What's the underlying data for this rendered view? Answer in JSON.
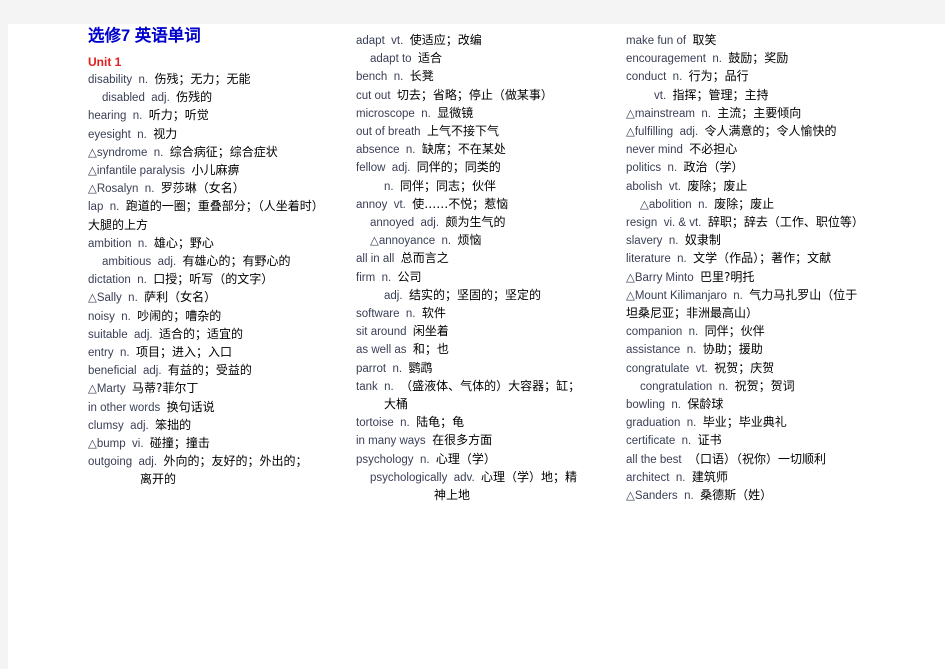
{
  "document": {
    "title": "选修7  英语单词",
    "unit": "Unit 1",
    "page_background": "#ffffff",
    "canvas_background": "#f4f4f4",
    "title_color": "#0000cc",
    "unit_color": "#e02020",
    "english_color": "#3a3f55",
    "chinese_color": "#000000"
  },
  "columns": [
    {
      "id": "column-1",
      "entries": [
        {
          "en": "disability",
          "pos": "n.",
          "zh": "伤残；无力；无能",
          "indent": 0
        },
        {
          "en": "disabled",
          "pos": "adj.",
          "zh": "伤残的",
          "indent": 1
        },
        {
          "en": "hearing",
          "pos": "n.",
          "zh": "听力；听觉",
          "indent": 0
        },
        {
          "en": "eyesight",
          "pos": "n.",
          "zh": "视力",
          "indent": 0
        },
        {
          "en": "△syndrome",
          "pos": "n.",
          "zh": "综合病征；综合症状",
          "indent": 0
        },
        {
          "en": "△infantile paralysis",
          "pos": "",
          "zh": "小儿麻痹",
          "indent": 0
        },
        {
          "en": "△Rosalyn",
          "pos": "n.",
          "zh": "罗莎琳（女名）",
          "indent": 0
        },
        {
          "en": "lap",
          "pos": "n.",
          "zh": "跑道的一圈；重叠部分；（人坐着时）",
          "indent": 0
        },
        {
          "en": "",
          "pos": "",
          "zh": "大腿的上方",
          "indent": 0
        },
        {
          "en": "ambition",
          "pos": "n.",
          "zh": "雄心；野心",
          "indent": 0
        },
        {
          "en": "ambitious",
          "pos": "adj.",
          "zh": "有雄心的；有野心的",
          "indent": 1
        },
        {
          "en": "dictation",
          "pos": "n.",
          "zh": "口授；听写（的文字）",
          "indent": 0
        },
        {
          "en": "△Sally",
          "pos": "n.",
          "zh": "萨利（女名）",
          "indent": 0
        },
        {
          "en": "noisy",
          "pos": "n.",
          "zh": "吵闹的；嘈杂的",
          "indent": 0
        },
        {
          "en": "suitable",
          "pos": "adj.",
          "zh": "适合的；适宜的",
          "indent": 0
        },
        {
          "en": "entry",
          "pos": "n.",
          "zh": "项目；进入；入口",
          "indent": 0
        },
        {
          "en": "beneficial",
          "pos": "adj.",
          "zh": "有益的；受益的",
          "indent": 0
        },
        {
          "en": "△Marty",
          "pos": "",
          "zh": "马蒂?菲尔丁",
          "indent": 0
        },
        {
          "en": "in other words",
          "pos": "",
          "zh": "换句话说",
          "indent": 0
        },
        {
          "en": "clumsy",
          "pos": "adj.",
          "zh": "笨拙的",
          "indent": 0
        },
        {
          "en": "△bump",
          "pos": "vi.",
          "zh": "碰撞；撞击",
          "indent": 0
        },
        {
          "en": "outgoing",
          "pos": "adj.",
          "zh": "外向的；友好的；外出的；",
          "indent": 0
        },
        {
          "en": "",
          "pos": "",
          "zh": "离开的",
          "indent": 3
        }
      ]
    },
    {
      "id": "column-2",
      "entries": [
        {
          "en": "adapt",
          "pos": "vt.",
          "zh": "使适应；改编",
          "indent": 0
        },
        {
          "en": "adapt to",
          "pos": "",
          "zh": "适合",
          "indent": 1
        },
        {
          "en": "bench",
          "pos": "n.",
          "zh": "长凳",
          "indent": 0
        },
        {
          "en": "cut out",
          "pos": "",
          "zh": "切去；省略；停止（做某事）",
          "indent": 0
        },
        {
          "en": "microscope",
          "pos": "n.",
          "zh": "显微镜",
          "indent": 0
        },
        {
          "en": "out of breath",
          "pos": "",
          "zh": "上气不接下气",
          "indent": 0
        },
        {
          "en": "absence",
          "pos": "n.",
          "zh": "缺席；不在某处",
          "indent": 0
        },
        {
          "en": "fellow",
          "pos": "adj.",
          "zh": "同伴的；同类的",
          "indent": 0
        },
        {
          "en": "",
          "pos": "n.",
          "zh": "同伴；同志；伙伴",
          "indent": 2
        },
        {
          "en": "annoy",
          "pos": "vt.",
          "zh": "使……不悦；惹恼",
          "indent": 0
        },
        {
          "en": "annoyed",
          "pos": "adj.",
          "zh": "颇为生气的",
          "indent": 1
        },
        {
          "en": "△annoyance",
          "pos": "n.",
          "zh": "烦恼",
          "indent": 1
        },
        {
          "en": "all in all",
          "pos": "",
          "zh": "总而言之",
          "indent": 0
        },
        {
          "en": "firm",
          "pos": "n.",
          "zh": "公司",
          "indent": 0
        },
        {
          "en": "",
          "pos": "adj.",
          "zh": "结实的；坚固的；坚定的",
          "indent": 2
        },
        {
          "en": "software",
          "pos": "n.",
          "zh": "软件",
          "indent": 0
        },
        {
          "en": "sit around",
          "pos": "",
          "zh": "闲坐着",
          "indent": 0
        },
        {
          "en": "as well as",
          "pos": "",
          "zh": "和；也",
          "indent": 0
        },
        {
          "en": "parrot",
          "pos": "n.",
          "zh": "鹦鹉",
          "indent": 0
        },
        {
          "en": "tank",
          "pos": "n.",
          "zh": "（盛液体、气体的）大容器；缸；",
          "indent": 0
        },
        {
          "en": "",
          "pos": "",
          "zh": "大桶",
          "indent": 2
        },
        {
          "en": "tortoise",
          "pos": "n.",
          "zh": "陆龟；龟",
          "indent": 0
        },
        {
          "en": "in many ways",
          "pos": "",
          "zh": "在很多方面",
          "indent": 0
        },
        {
          "en": "psychology",
          "pos": "n.",
          "zh": "心理（学）",
          "indent": 0
        },
        {
          "en": "psychologically",
          "pos": "adv.",
          "zh": "心理（学）地；精",
          "indent": 1
        },
        {
          "en": "",
          "pos": "",
          "zh": "神上地",
          "indent": 4
        }
      ]
    },
    {
      "id": "column-3",
      "entries": [
        {
          "en": "make fun of",
          "pos": "",
          "zh": "取笑",
          "indent": 0
        },
        {
          "en": "encouragement",
          "pos": "n.",
          "zh": "鼓励；奖励",
          "indent": 0
        },
        {
          "en": "conduct",
          "pos": "n.",
          "zh": "行为；品行",
          "indent": 0
        },
        {
          "en": "",
          "pos": "vt.",
          "zh": "指挥；管理；主持",
          "indent": 2
        },
        {
          "en": "△mainstream",
          "pos": "n.",
          "zh": "主流；主要倾向",
          "indent": 0
        },
        {
          "en": "△fulfilling",
          "pos": "adj.",
          "zh": "令人满意的；令人愉快的",
          "indent": 0
        },
        {
          "en": "never mind",
          "pos": "",
          "zh": "不必担心",
          "indent": 0
        },
        {
          "en": "politics",
          "pos": "n.",
          "zh": "政治（学）",
          "indent": 0
        },
        {
          "en": "abolish",
          "pos": "vt.",
          "zh": "废除；废止",
          "indent": 0
        },
        {
          "en": "△abolition",
          "pos": "n.",
          "zh": "废除；废止",
          "indent": 1
        },
        {
          "en": "resign",
          "pos": "vi. & vt.",
          "zh": "辞职；辞去（工作、职位等）",
          "indent": 0
        },
        {
          "en": "slavery",
          "pos": "n.",
          "zh": "奴隶制",
          "indent": 0
        },
        {
          "en": "literature",
          "pos": "n.",
          "zh": "文学（作品）；著作；文献",
          "indent": 0
        },
        {
          "en": "△Barry Minto",
          "pos": "",
          "zh": "巴里?明托",
          "indent": 0
        },
        {
          "en": "△Mount Kilimanjaro",
          "pos": "n.",
          "zh": "气力马扎罗山（位于",
          "indent": 0
        },
        {
          "en": "",
          "pos": "",
          "zh": "坦桑尼亚；非洲最高山）",
          "indent": 0
        },
        {
          "en": "companion",
          "pos": "n.",
          "zh": "同伴；伙伴",
          "indent": 0
        },
        {
          "en": "assistance",
          "pos": "n.",
          "zh": "协助；援助",
          "indent": 0
        },
        {
          "en": "congratulate",
          "pos": "vt.",
          "zh": "祝贺；庆贺",
          "indent": 0
        },
        {
          "en": "congratulation",
          "pos": "n.",
          "zh": "祝贺；贺词",
          "indent": 1
        },
        {
          "en": "bowling",
          "pos": "n.",
          "zh": "保龄球",
          "indent": 0
        },
        {
          "en": "graduation",
          "pos": "n.",
          "zh": "毕业；毕业典礼",
          "indent": 0
        },
        {
          "en": "certificate",
          "pos": "n.",
          "zh": "证书",
          "indent": 0
        },
        {
          "en": "all the best",
          "pos": "",
          "zh": "（口语）（祝你）一切顺利",
          "indent": 0
        },
        {
          "en": "architect",
          "pos": "n.",
          "zh": "建筑师",
          "indent": 0
        },
        {
          "en": "△Sanders",
          "pos": "n.",
          "zh": "桑德斯（姓）",
          "indent": 0
        }
      ]
    }
  ]
}
